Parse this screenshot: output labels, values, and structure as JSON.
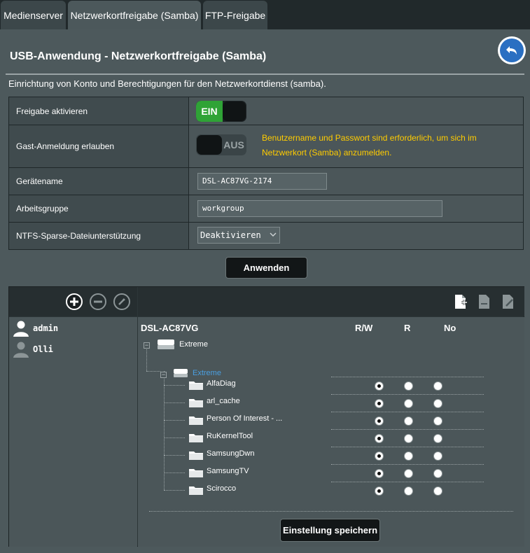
{
  "tabs": [
    {
      "label": "Medienserver",
      "active": false
    },
    {
      "label": "Netzwerkortfreigabe (Samba)",
      "active": true
    },
    {
      "label": "FTP-Freigabe",
      "active": false
    }
  ],
  "page": {
    "title": "USB-Anwendung - Netzwerkortfreigabe (Samba)",
    "description": "Einrichtung von Konto und Berechtigungen für den Netzwerkortdienst (samba)."
  },
  "settings": {
    "enable_share": {
      "label": "Freigabe aktivieren",
      "state": "EIN"
    },
    "guest_login": {
      "label": "Gast-Anmeldung erlauben",
      "state": "AUS",
      "note": "Benutzername und Passwort sind erforderlich, um sich im Netzwerkort (Samba) anzumelden."
    },
    "device_name": {
      "label": "Gerätename",
      "value": "DSL-AC87VG-2174"
    },
    "workgroup": {
      "label": "Arbeitsgruppe",
      "value": "workgroup"
    },
    "ntfs_sparse": {
      "label": "NTFS-Sparse-Dateiunterstützung",
      "value": "Deaktivieren"
    }
  },
  "apply_button": "Anwenden",
  "users": [
    {
      "name": "admin",
      "selected": true
    },
    {
      "name": "Olli",
      "selected": false
    }
  ],
  "permissions": {
    "device": "DSL-AC87VG",
    "columns": [
      "R/W",
      "R",
      "No"
    ],
    "disk": "Extreme",
    "partition": "Extreme",
    "folders": [
      {
        "name": "AlfaDiag",
        "perm": "R/W"
      },
      {
        "name": "arl_cache",
        "perm": "R/W"
      },
      {
        "name": "Person Of Interest - ...",
        "perm": "R/W"
      },
      {
        "name": "RuKernelTool",
        "perm": "R/W"
      },
      {
        "name": "SamsungDwn",
        "perm": "R/W"
      },
      {
        "name": "SamsungTV",
        "perm": "R/W"
      },
      {
        "name": "Scirocco",
        "perm": "R/W"
      }
    ]
  },
  "save_button": "Einstellung speichern",
  "colors": {
    "toggle_on": "#2fa336",
    "note": "#ffcc00",
    "partition_link": "#4a9fe0",
    "back_button": "#2a6fc2"
  }
}
